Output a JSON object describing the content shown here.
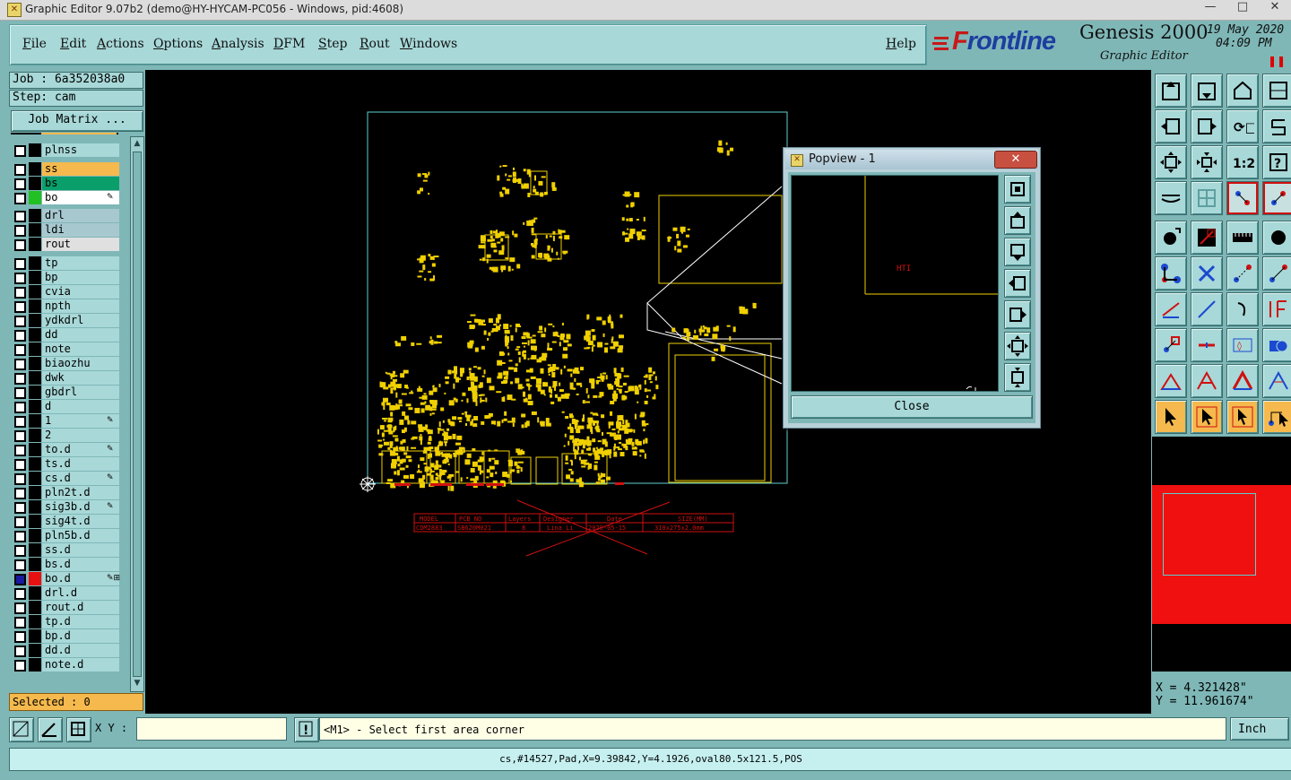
{
  "window": {
    "title": "Graphic Editor 9.07b2 (demo@HY-HYCAM-PC056 - Windows, pid:4608)",
    "controls": [
      "—",
      "□",
      "✕"
    ]
  },
  "menu": {
    "items": [
      "File",
      "Edit",
      "Actions",
      "Options",
      "Analysis",
      "DFM",
      "Step",
      "Rout",
      "Windows"
    ],
    "help": "Help"
  },
  "brand": {
    "logo": "Frontline",
    "product": "Genesis 2000",
    "subtitle": "Graphic Editor",
    "date": "19 May 2020",
    "time": "04:09 PM"
  },
  "job": {
    "job_line": "Job : 6a352038a0",
    "step_line": "Step: cam",
    "matrix_button": "Job Matrix ..."
  },
  "layers": [
    {
      "name": "plnss",
      "color": "#000000"
    },
    {
      "name": "ss",
      "color": "#000000",
      "bg": "#f5b94d"
    },
    {
      "name": "bs",
      "color": "#000000",
      "bg": "#0a9e6a"
    },
    {
      "name": "bo",
      "color": "#22c022",
      "bg": "#ffffff",
      "edit": "✎"
    },
    {
      "name": "drl",
      "color": "#000000",
      "bg": "#a8c8d0"
    },
    {
      "name": "ldi",
      "color": "#000000",
      "bg": "#a8c8d0"
    },
    {
      "name": "rout",
      "color": "#000000",
      "bg": "#e0e0e0"
    },
    {
      "name": "tp",
      "color": "#000000"
    },
    {
      "name": "bp",
      "color": "#000000"
    },
    {
      "name": "cvia",
      "color": "#000000"
    },
    {
      "name": "npth",
      "color": "#000000"
    },
    {
      "name": "ydkdrl",
      "color": "#000000"
    },
    {
      "name": "dd",
      "color": "#000000"
    },
    {
      "name": "note",
      "color": "#000000"
    },
    {
      "name": "biaozhu",
      "color": "#000000"
    },
    {
      "name": "dwk",
      "color": "#000000"
    },
    {
      "name": "gbdrl",
      "color": "#000000"
    },
    {
      "name": "d",
      "color": "#000000"
    },
    {
      "name": "1",
      "color": "#000000",
      "edit": "✎"
    },
    {
      "name": "2",
      "color": "#000000"
    },
    {
      "name": "to.d",
      "color": "#000000",
      "edit": "✎"
    },
    {
      "name": "ts.d",
      "color": "#000000"
    },
    {
      "name": "cs.d",
      "color": "#000000",
      "edit": "✎"
    },
    {
      "name": "pln2t.d",
      "color": "#000000"
    },
    {
      "name": "sig3b.d",
      "color": "#000000",
      "edit": "✎"
    },
    {
      "name": "sig4t.d",
      "color": "#000000"
    },
    {
      "name": "pln5b.d",
      "color": "#000000"
    },
    {
      "name": "ss.d",
      "color": "#000000"
    },
    {
      "name": "bs.d",
      "color": "#000000"
    },
    {
      "name": "bo.d",
      "color": "#e81010",
      "edit": "✎⊞",
      "checked": true
    },
    {
      "name": "drl.d",
      "color": "#000000"
    },
    {
      "name": "rout.d",
      "color": "#000000"
    },
    {
      "name": "tp.d",
      "color": "#000000"
    },
    {
      "name": "bp.d",
      "color": "#000000"
    },
    {
      "name": "dd.d",
      "color": "#000000"
    },
    {
      "name": "note.d",
      "color": "#000000"
    }
  ],
  "selected": "Selected : 0",
  "board_table": {
    "headers": [
      "MODEL",
      "PCB_NO",
      "Layers",
      "Designer",
      "Date",
      "SIZE(MM)"
    ],
    "values": [
      "CDM2883",
      "SB620M021",
      "8",
      "Lina Li",
      "2020-05-15",
      "310x275x2.0mm"
    ]
  },
  "popview": {
    "title": "Popview - 1",
    "close_x": "✕",
    "close_button": "Close",
    "label": "HTI"
  },
  "coords": {
    "x": "X = 4.321428\"",
    "y": "Y = 11.961674\""
  },
  "bottom": {
    "xy_label": "X Y :",
    "xy_value": "",
    "prompt": "<M1> - Select first area corner",
    "units": "Inch"
  },
  "status": "cs,#14527,Pad,X=9.39842,Y=4.1926,oval80.5x121.5,POS",
  "colors": {
    "panel": "#a8d8d8",
    "background": "#7fb7b7",
    "layer_active": "#e81010",
    "pcb_yellow": "#f0d000"
  }
}
